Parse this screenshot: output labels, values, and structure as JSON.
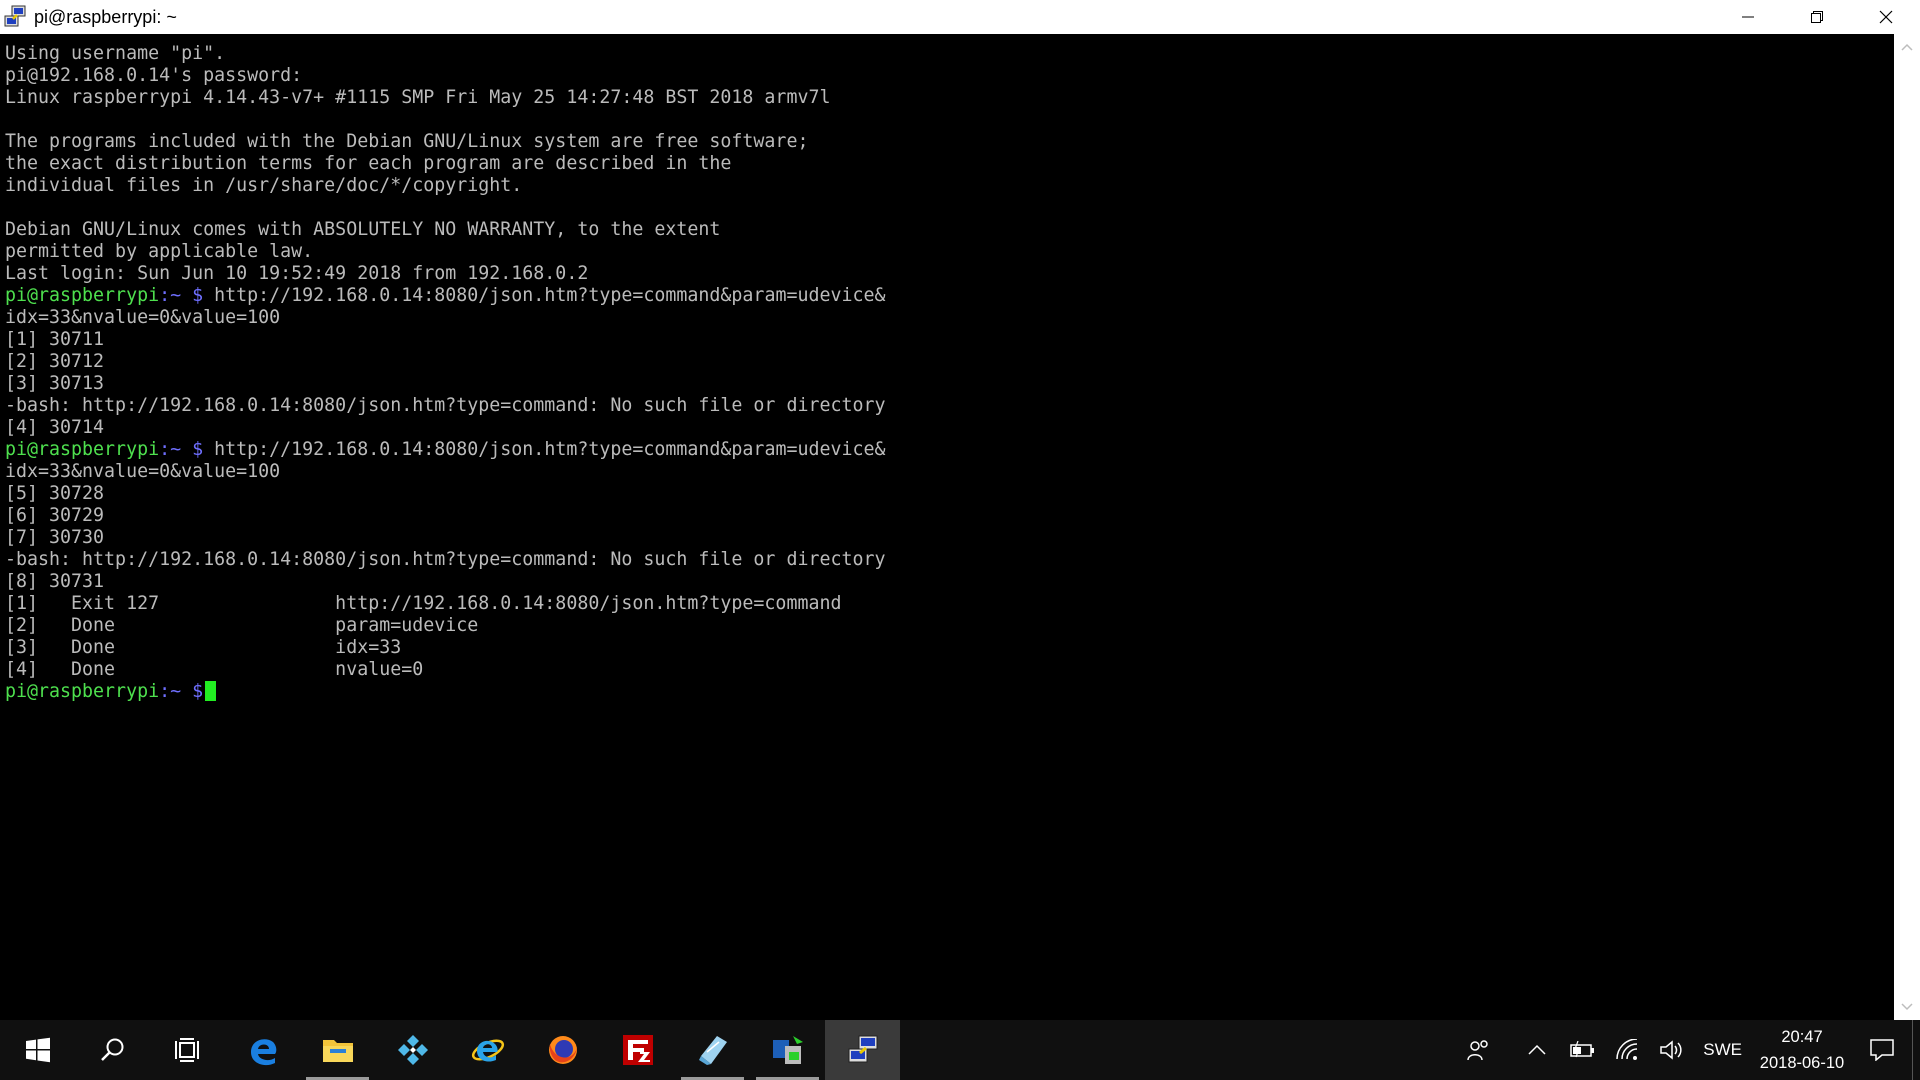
{
  "window": {
    "title": "pi@raspberrypi: ~"
  },
  "terminal": {
    "prompt": {
      "user_host": "pi@raspberrypi",
      "path_symbol": ":~ $"
    },
    "lines": [
      "Using username \"pi\".",
      "pi@192.168.0.14's password:",
      "Linux raspberrypi 4.14.43-v7+ #1115 SMP Fri May 25 14:27:48 BST 2018 armv7l",
      "",
      "The programs included with the Debian GNU/Linux system are free software;",
      "the exact distribution terms for each program are described in the",
      "individual files in /usr/share/doc/*/copyright.",
      "",
      "Debian GNU/Linux comes with ABSOLUTELY NO WARRANTY, to the extent",
      "permitted by applicable law.",
      "Last login: Sun Jun 10 19:52:49 2018 from 192.168.0.2"
    ],
    "command1": " http://192.168.0.14:8080/json.htm?type=command&param=udevice&",
    "lines2": [
      "idx=33&nvalue=0&value=100",
      "[1] 30711",
      "[2] 30712",
      "[3] 30713",
      "-bash: http://192.168.0.14:8080/json.htm?type=command: No such file or directory",
      "[4] 30714"
    ],
    "command2": " http://192.168.0.14:8080/json.htm?type=command&param=udevice&",
    "lines3": [
      "idx=33&nvalue=0&value=100",
      "[5] 30728",
      "[6] 30729",
      "[7] 30730",
      "-bash: http://192.168.0.14:8080/json.htm?type=command: No such file or directory",
      "[8] 30731",
      "[1]   Exit 127                http://192.168.0.14:8080/json.htm?type=command",
      "[2]   Done                    param=udevice",
      "[3]   Done                    idx=33",
      "[4]   Done                    nvalue=0"
    ]
  },
  "taskbar": {
    "apps": [
      {
        "name": "start-icon"
      },
      {
        "name": "search-icon"
      },
      {
        "name": "task-view-icon"
      },
      {
        "name": "edge-icon"
      },
      {
        "name": "file-explorer-icon"
      },
      {
        "name": "kodi-icon"
      },
      {
        "name": "internet-explorer-icon"
      },
      {
        "name": "firefox-icon"
      },
      {
        "name": "filezilla-icon"
      },
      {
        "name": "notepad-icon"
      },
      {
        "name": "network-tool-icon"
      },
      {
        "name": "putty-icon"
      }
    ],
    "tray": {
      "language": "SWE",
      "time": "20:47",
      "date": "2018-06-10"
    }
  },
  "colors": {
    "prompt_user": "#4ee04e",
    "prompt_path": "#6f6fff",
    "text": "#bbbbbb",
    "cursor": "#22ee22",
    "taskbar": "#101010"
  }
}
